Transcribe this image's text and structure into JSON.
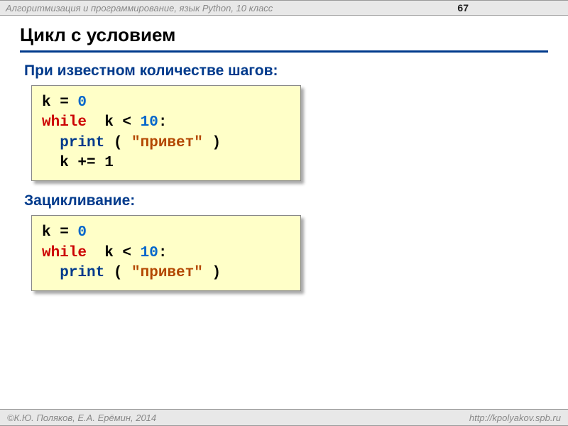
{
  "header": {
    "course": "Алгоритмизация и программирование, язык Python, 10 класс",
    "page": "67"
  },
  "title": "Цикл с условием",
  "section1": {
    "heading": "При известном количестве шагов:",
    "code": {
      "l1a": "k = ",
      "l1b": "0",
      "l2a": "while",
      "l2b": "  k < ",
      "l2c": "10",
      "l2d": ":",
      "l3a": "  ",
      "l3b": "print",
      "l3c": " ( ",
      "l3d": "\"привет\"",
      "l3e": " )",
      "l4": "  k += 1"
    }
  },
  "section2": {
    "heading": "Зацикливание:",
    "code": {
      "l1a": "k = ",
      "l1b": "0",
      "l2a": "while",
      "l2b": "  k < ",
      "l2c": "10",
      "l2d": ":",
      "l3a": "  ",
      "l3b": "print",
      "l3c": " ( ",
      "l3d": "\"привет\"",
      "l3e": " )"
    }
  },
  "footer": {
    "left": "©К.Ю. Поляков, Е.А. Ерёмин, 2014",
    "right": "http://kpolyakov.spb.ru"
  }
}
